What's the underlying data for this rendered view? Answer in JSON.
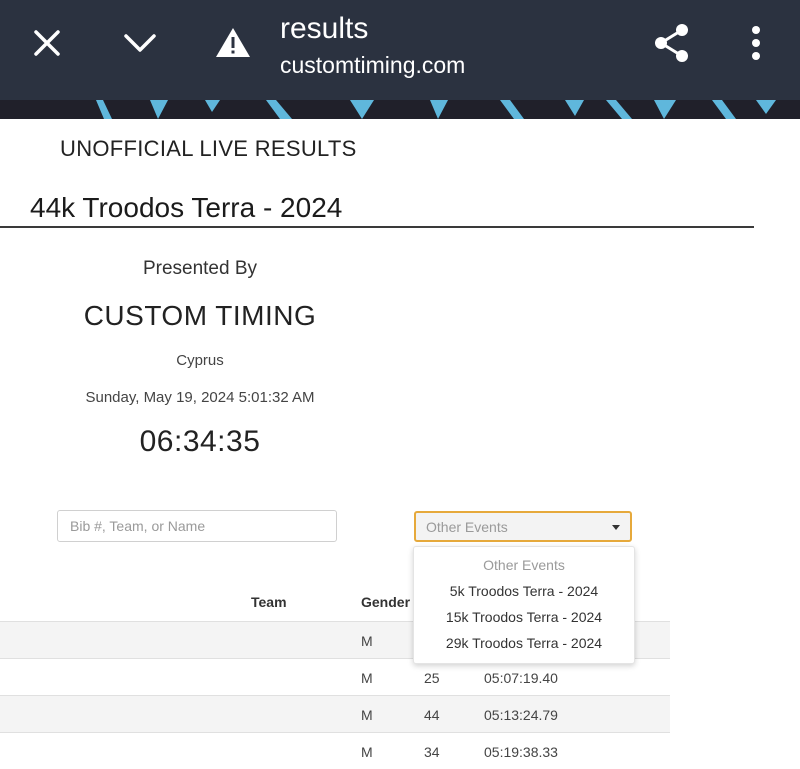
{
  "browser": {
    "page_title": "results",
    "url": "customtiming.com",
    "icons": [
      "close-icon",
      "chevron-down-icon",
      "warning-icon",
      "share-icon",
      "more-vert-icon"
    ],
    "bar_color": "#2b3240"
  },
  "page": {
    "unofficial_label": "UNOFFICIAL LIVE RESULTS",
    "event_title": "44k Troodos Terra - 2024",
    "presented_by": "Presented By",
    "company": "CUSTOM TIMING",
    "location": "Cyprus",
    "timestamp": "Sunday, May 19, 2024 5:01:32 AM",
    "elapsed_clock": "06:34:35"
  },
  "search": {
    "placeholder": "Bib #, Team, or Name",
    "value": ""
  },
  "events_select": {
    "selected": "Other Events",
    "accent_color": "#e6a93b",
    "options": [
      "Other Events",
      "5k Troodos Terra - 2024",
      "15k Troodos Terra - 2024",
      "29k Troodos Terra - 2024"
    ]
  },
  "table": {
    "columns": [
      "Team",
      "Gender"
    ],
    "rows": [
      {
        "gender": "M",
        "age": "",
        "time": ""
      },
      {
        "gender": "M",
        "age": "25",
        "time": "05:07:19.40"
      },
      {
        "gender": "M",
        "age": "44",
        "time": "05:13:24.79"
      },
      {
        "gender": "M",
        "age": "34",
        "time": "05:19:38.33"
      }
    ]
  }
}
